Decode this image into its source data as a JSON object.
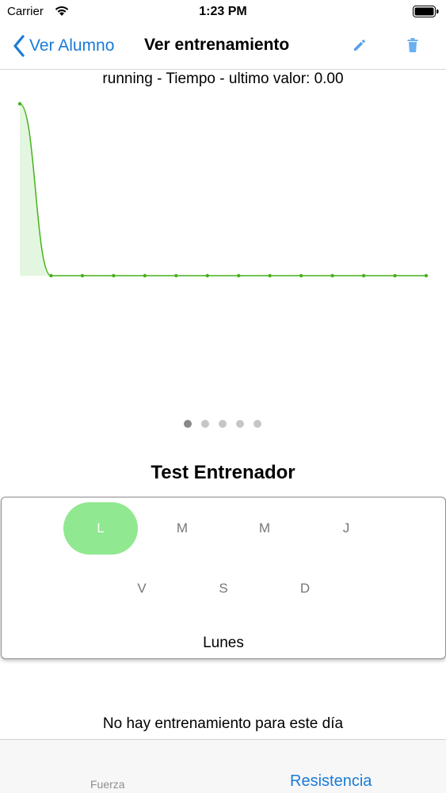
{
  "status_bar": {
    "carrier": "Carrier",
    "time": "1:23 PM"
  },
  "nav": {
    "back_label": "Ver Alumno",
    "title": "Ver entrenamiento"
  },
  "chart_data": {
    "type": "area",
    "title": "running - Tiempo - ultimo valor: 0.00",
    "x": [
      0,
      1,
      2,
      3,
      4,
      5,
      6,
      7,
      8,
      9,
      10,
      11,
      12,
      13
    ],
    "y": [
      1,
      0,
      0,
      0,
      0,
      0,
      0,
      0,
      0,
      0,
      0,
      0,
      0,
      0
    ],
    "ylim": [
      0,
      1
    ],
    "grid": false,
    "series_color": "#45b21b",
    "fill_color": "#e3f6df"
  },
  "pager": {
    "count": 5,
    "active": 0
  },
  "section": {
    "title": "Test Entrenador"
  },
  "days": {
    "items": [
      "L",
      "M",
      "M",
      "J",
      "V",
      "S",
      "D"
    ],
    "selected_index": 0,
    "selected_label": "Lunes",
    "selected_color": "#90e890"
  },
  "message": {
    "empty": "No hay entrenamiento para este día"
  },
  "tabs": {
    "strength": "Fuerza",
    "endurance": "Resistencia"
  },
  "colors": {
    "accent": "#1a7bd7",
    "edit_icon": "#5aa0e8",
    "delete_icon": "#6ab0f0"
  }
}
